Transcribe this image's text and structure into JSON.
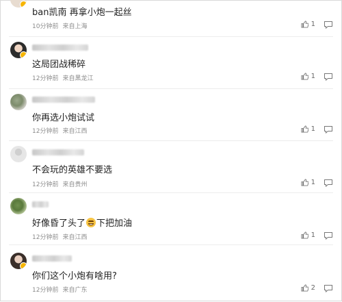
{
  "comments": [
    {
      "text_parts": [
        "ban凯南 再拿小炮一起丝"
      ],
      "time": "10分钟前",
      "location": "来自上海",
      "likes": "1"
    },
    {
      "text_parts": [
        "这局团战稀碎"
      ],
      "time": "12分钟前",
      "location": "来自黑龙江",
      "likes": "1"
    },
    {
      "text_parts": [
        "你再选小炮试试"
      ],
      "time": "12分钟前",
      "location": "来自江西",
      "likes": "1"
    },
    {
      "text_parts": [
        "不会玩的英雄不要选"
      ],
      "time": "12分钟前",
      "location": "来自贵州",
      "likes": "1"
    },
    {
      "text_parts": [
        "好像昏了头了",
        "下把加油"
      ],
      "emoji": "grinning-sweat-emoji",
      "time": "12分钟前",
      "location": "来自江西",
      "likes": "1"
    },
    {
      "text_parts": [
        "你们这个小炮有啥用?"
      ],
      "time": "12分钟前",
      "location": "来自广东",
      "likes": "2"
    }
  ],
  "icons": {
    "like": "thumbs-up-icon",
    "reply": "comment-bubble-icon"
  },
  "colors": {
    "vip_badge": "#f7b500",
    "meta_text": "#8c8c8c",
    "divider": "#ececec"
  }
}
